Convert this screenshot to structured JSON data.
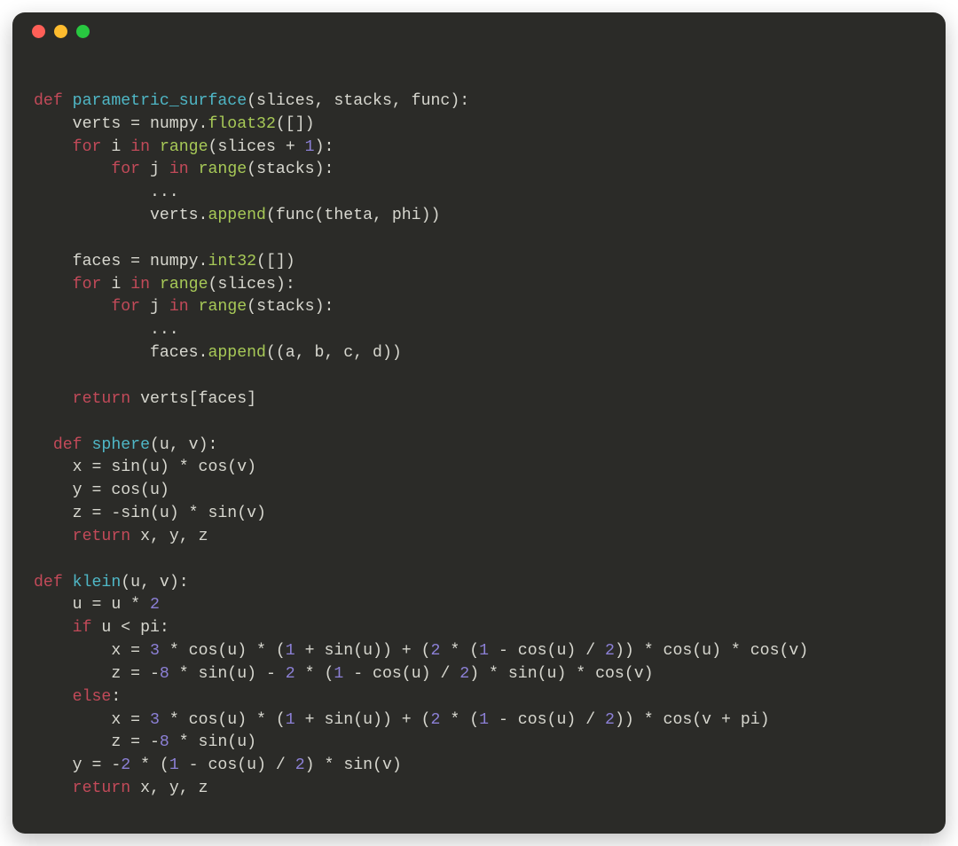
{
  "tokens": [
    [
      "\n",
      null
    ],
    [
      "def ",
      "kw"
    ],
    [
      "parametric_surface",
      "fnname"
    ],
    [
      "(slices, stacks, func):",
      null
    ],
    [
      "\n",
      null
    ],
    [
      "    verts = numpy.",
      null
    ],
    [
      "float32",
      "call"
    ],
    [
      "([])",
      null
    ],
    [
      "\n",
      null
    ],
    [
      "    ",
      null
    ],
    [
      "for ",
      "kw"
    ],
    [
      "i ",
      null
    ],
    [
      "in ",
      "kw"
    ],
    [
      "range",
      "call"
    ],
    [
      "(slices + ",
      null
    ],
    [
      "1",
      "num"
    ],
    [
      "):",
      null
    ],
    [
      "\n",
      null
    ],
    [
      "        ",
      null
    ],
    [
      "for ",
      "kw"
    ],
    [
      "j ",
      null
    ],
    [
      "in ",
      "kw"
    ],
    [
      "range",
      "call"
    ],
    [
      "(stacks):",
      null
    ],
    [
      "\n",
      null
    ],
    [
      "            ...",
      null
    ],
    [
      "\n",
      null
    ],
    [
      "            verts.",
      null
    ],
    [
      "append",
      "call"
    ],
    [
      "(func(theta, phi))",
      null
    ],
    [
      "\n",
      null
    ],
    [
      "\n",
      null
    ],
    [
      "    faces = numpy.",
      null
    ],
    [
      "int32",
      "call"
    ],
    [
      "([])",
      null
    ],
    [
      "\n",
      null
    ],
    [
      "    ",
      null
    ],
    [
      "for ",
      "kw"
    ],
    [
      "i ",
      null
    ],
    [
      "in ",
      "kw"
    ],
    [
      "range",
      "call"
    ],
    [
      "(slices):",
      null
    ],
    [
      "\n",
      null
    ],
    [
      "        ",
      null
    ],
    [
      "for ",
      "kw"
    ],
    [
      "j ",
      null
    ],
    [
      "in ",
      "kw"
    ],
    [
      "range",
      "call"
    ],
    [
      "(stacks):",
      null
    ],
    [
      "\n",
      null
    ],
    [
      "            ...",
      null
    ],
    [
      "\n",
      null
    ],
    [
      "            faces.",
      null
    ],
    [
      "append",
      "call"
    ],
    [
      "((a, b, c, d))",
      null
    ],
    [
      "\n",
      null
    ],
    [
      "\n",
      null
    ],
    [
      "    ",
      null
    ],
    [
      "return ",
      "kw"
    ],
    [
      "verts[faces]",
      null
    ],
    [
      "\n",
      null
    ],
    [
      "\n",
      null
    ],
    [
      "  ",
      null
    ],
    [
      "def ",
      "kw"
    ],
    [
      "sphere",
      "fnname"
    ],
    [
      "(u, v):",
      null
    ],
    [
      "\n",
      null
    ],
    [
      "    x = sin(u) * cos(v)",
      null
    ],
    [
      "\n",
      null
    ],
    [
      "    y = cos(u)",
      null
    ],
    [
      "\n",
      null
    ],
    [
      "    z = -sin(u) * sin(v)",
      null
    ],
    [
      "\n",
      null
    ],
    [
      "    ",
      null
    ],
    [
      "return ",
      "kw"
    ],
    [
      "x, y, z",
      null
    ],
    [
      "\n",
      null
    ],
    [
      "\n",
      null
    ],
    [
      "def ",
      "kw"
    ],
    [
      "klein",
      "fnname"
    ],
    [
      "(u, v):",
      null
    ],
    [
      "\n",
      null
    ],
    [
      "    u = u * ",
      null
    ],
    [
      "2",
      "num"
    ],
    [
      "\n",
      null
    ],
    [
      "    ",
      null
    ],
    [
      "if ",
      "kw"
    ],
    [
      "u < pi:",
      null
    ],
    [
      "\n",
      null
    ],
    [
      "        x = ",
      null
    ],
    [
      "3",
      "num"
    ],
    [
      " * cos(u) * (",
      null
    ],
    [
      "1",
      "num"
    ],
    [
      " + sin(u)) + (",
      null
    ],
    [
      "2",
      "num"
    ],
    [
      " * (",
      null
    ],
    [
      "1",
      "num"
    ],
    [
      " - cos(u) / ",
      null
    ],
    [
      "2",
      "num"
    ],
    [
      ")) * cos(u) * cos(v)",
      null
    ],
    [
      "\n",
      null
    ],
    [
      "        z = -",
      null
    ],
    [
      "8",
      "num"
    ],
    [
      " * sin(u) - ",
      null
    ],
    [
      "2",
      "num"
    ],
    [
      " * (",
      null
    ],
    [
      "1",
      "num"
    ],
    [
      " - cos(u) / ",
      null
    ],
    [
      "2",
      "num"
    ],
    [
      ") * sin(u) * cos(v)",
      null
    ],
    [
      "\n",
      null
    ],
    [
      "    ",
      null
    ],
    [
      "else",
      "kw"
    ],
    [
      ":",
      null
    ],
    [
      "\n",
      null
    ],
    [
      "        x = ",
      null
    ],
    [
      "3",
      "num"
    ],
    [
      " * cos(u) * (",
      null
    ],
    [
      "1",
      "num"
    ],
    [
      " + sin(u)) + (",
      null
    ],
    [
      "2",
      "num"
    ],
    [
      " * (",
      null
    ],
    [
      "1",
      "num"
    ],
    [
      " - cos(u) / ",
      null
    ],
    [
      "2",
      "num"
    ],
    [
      ")) * cos(v + pi)",
      null
    ],
    [
      "\n",
      null
    ],
    [
      "        z = -",
      null
    ],
    [
      "8",
      "num"
    ],
    [
      " * sin(u)",
      null
    ],
    [
      "\n",
      null
    ],
    [
      "    y = -",
      null
    ],
    [
      "2",
      "num"
    ],
    [
      " * (",
      null
    ],
    [
      "1",
      "num"
    ],
    [
      " - cos(u) / ",
      null
    ],
    [
      "2",
      "num"
    ],
    [
      ") * sin(v)",
      null
    ],
    [
      "\n",
      null
    ],
    [
      "    ",
      null
    ],
    [
      "return ",
      "kw"
    ],
    [
      "x, y, z",
      null
    ],
    [
      "\n",
      null
    ]
  ]
}
